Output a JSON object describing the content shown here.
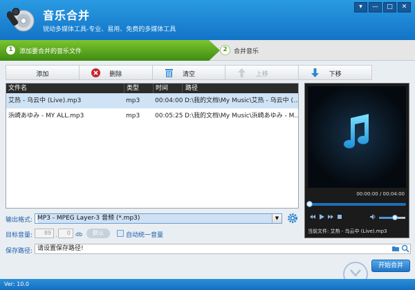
{
  "app": {
    "title": "音乐合并",
    "subtitle": "锐动多媒体工具-专业、易用、免费的多媒体工具"
  },
  "window_controls": [
    "▾",
    "—",
    "□",
    "✕"
  ],
  "steps": [
    {
      "num": "1",
      "label": "添加要合并的音乐文件"
    },
    {
      "num": "2",
      "label": "合并音乐"
    }
  ],
  "toolbar": {
    "add": "添加",
    "delete": "删除",
    "clear": "清空",
    "move_up": "上移",
    "move_down": "下移"
  },
  "file_list": {
    "headers": [
      "文件名",
      "类型",
      "时间",
      "路径"
    ],
    "rows": [
      {
        "name": "艾热 - 乌云中 (Live).mp3",
        "type": "mp3",
        "time": "00:04:00",
        "path": "D:\\我的文档\\My Music\\艾热 - 乌云中 (..."
      },
      {
        "name": "浜崎あゆみ - MY ALL.mp3",
        "type": "mp3",
        "time": "00:05:25",
        "path": "D:\\我的文档\\My Music\\浜崎あゆみ - M..."
      }
    ]
  },
  "player": {
    "time": "00:00:00 / 00:04:00",
    "progress": 0,
    "volume": 0.6,
    "now_playing": "当前文件: 艾热 - 乌云中 (Live).mp3"
  },
  "form": {
    "output_format_label": "输出格式:",
    "output_format_value": "MP3 - MPEG Layer-3 音频 (*.mp3)",
    "target_volume_label": "目标音量:",
    "volume_int": "89",
    "volume_dec": "0",
    "volume_unit": "db",
    "default_btn": "默认",
    "auto_unify_label": "自动统一音量",
    "save_path_label": "保存路径:",
    "save_path_value": "请设置保存路径!",
    "start_btn": "开始合并"
  },
  "footer": {
    "version": "Ver: 10.0"
  },
  "colors": {
    "titlebar": "#1a86d6",
    "step_active": "#4f9e18",
    "accent": "#1e5ea8"
  }
}
